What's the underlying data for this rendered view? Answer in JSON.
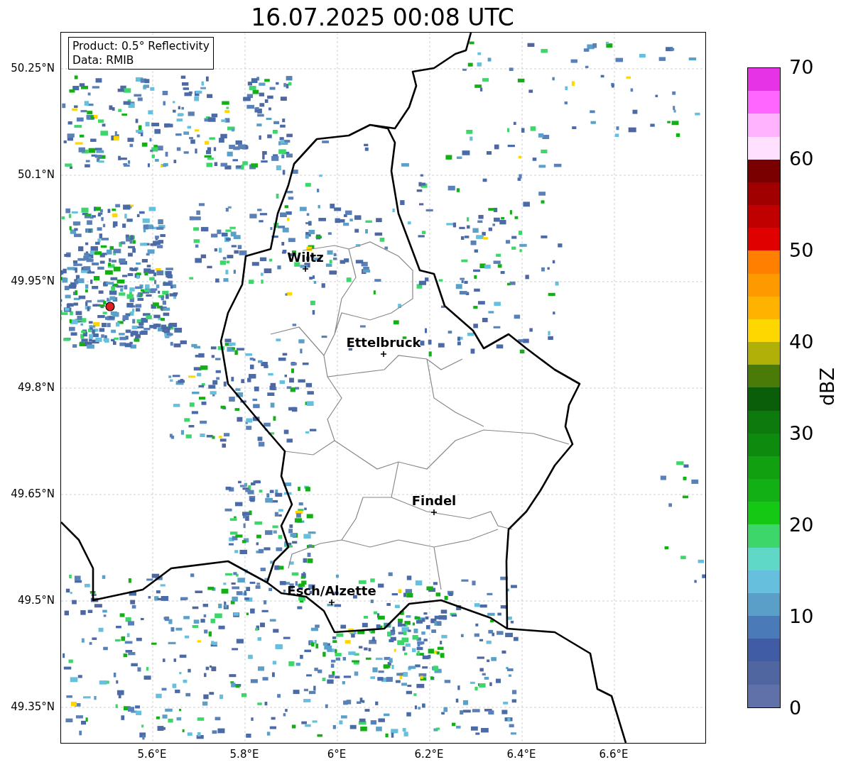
{
  "title": "16.07.2025 00:08 UTC",
  "info_box": {
    "lines": [
      "Product: 0.5° Reflectivity",
      "Data: RMIB"
    ]
  },
  "map": {
    "y_ticks": [
      "50.25°N",
      "50.1°N",
      "49.95°N",
      "49.8°N",
      "49.65°N",
      "49.5°N",
      "49.35°N"
    ],
    "x_ticks": [
      "5.6°E",
      "5.8°E",
      "6°E",
      "6.2°E",
      "6.4°E",
      "6.6°E"
    ],
    "cities": [
      {
        "name": "Wiltz"
      },
      {
        "name": "Ettelbruck"
      },
      {
        "name": "Findel"
      },
      {
        "name": "Esch/Alzette"
      }
    ]
  },
  "colorbar": {
    "label": "dBZ",
    "ticks": [
      "70",
      "60",
      "50",
      "40",
      "30",
      "20",
      "10",
      "0"
    ],
    "segments": [
      {
        "color": "#e633e6"
      },
      {
        "color": "#ff66ff"
      },
      {
        "color": "#ffb3ff"
      },
      {
        "color": "#ffe0ff"
      },
      {
        "color": "#7a0000"
      },
      {
        "color": "#a00000"
      },
      {
        "color": "#c00000"
      },
      {
        "color": "#e00000"
      },
      {
        "color": "#ff8000"
      },
      {
        "color": "#ff9900"
      },
      {
        "color": "#ffb300"
      },
      {
        "color": "#ffd700"
      },
      {
        "color": "#b0b008"
      },
      {
        "color": "#4a7a08"
      },
      {
        "color": "#0a5e0a"
      },
      {
        "color": "#0c7a0c"
      },
      {
        "color": "#0e8a0e"
      },
      {
        "color": "#10a010"
      },
      {
        "color": "#12b014"
      },
      {
        "color": "#14c814"
      },
      {
        "color": "#3dd66a"
      },
      {
        "color": "#5fd8c8"
      },
      {
        "color": "#66c0dd"
      },
      {
        "color": "#5a9fc8"
      },
      {
        "color": "#4a7ab8"
      },
      {
        "color": "#405ca4"
      },
      {
        "color": "#5066a0"
      },
      {
        "color": "#6070a8"
      }
    ]
  }
}
